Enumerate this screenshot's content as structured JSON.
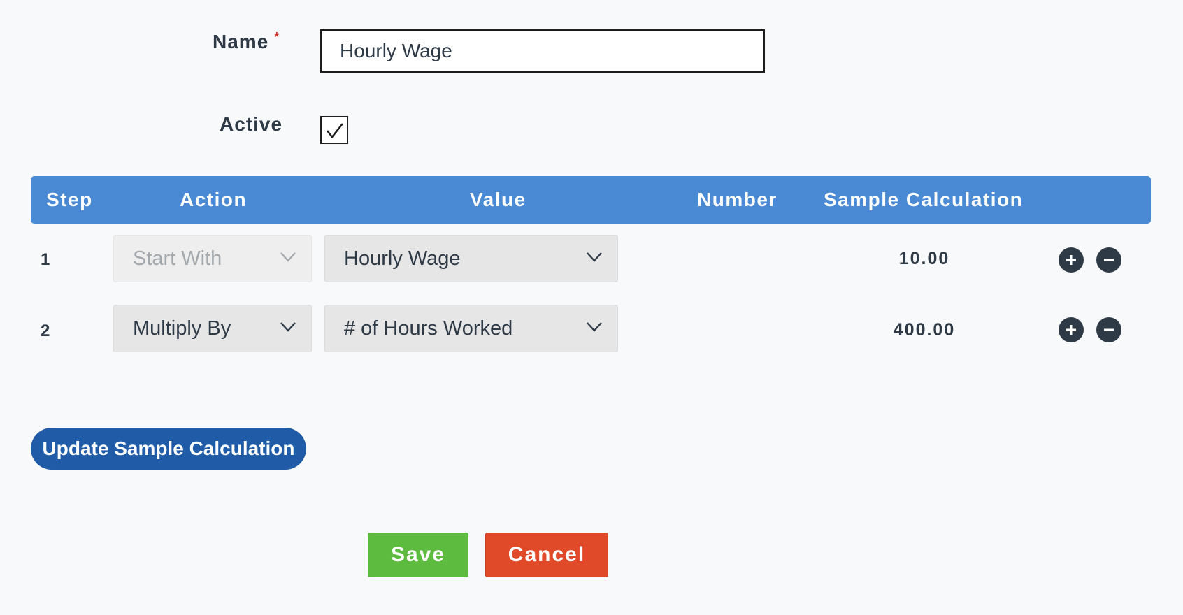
{
  "form": {
    "name_label": "Name",
    "required_marker": "*",
    "name_value": "Hourly Wage",
    "active_label": "Active",
    "active_checked": true
  },
  "table": {
    "headers": {
      "step": "Step",
      "action": "Action",
      "value": "Value",
      "number": "Number",
      "sample": "Sample Calculation"
    },
    "rows": [
      {
        "step": "1",
        "action": "Start With",
        "action_disabled": true,
        "value": "Hourly Wage",
        "number": "",
        "sample": "10.00"
      },
      {
        "step": "2",
        "action": "Multiply By",
        "action_disabled": false,
        "value": "# of Hours Worked",
        "number": "",
        "sample": "400.00"
      }
    ]
  },
  "buttons": {
    "update": "Update Sample Calculation",
    "save": "Save",
    "cancel": "Cancel"
  },
  "icons": {
    "add": "plus-circle-icon",
    "remove": "minus-circle-icon",
    "dropdown": "chevron-down-icon",
    "check": "checkmark-icon"
  },
  "colors": {
    "header_bg": "#4a89d3",
    "update_bg": "#1f5ba6",
    "save_bg": "#5dbb3f",
    "cancel_bg": "#e04a28",
    "required": "#d0302a"
  }
}
